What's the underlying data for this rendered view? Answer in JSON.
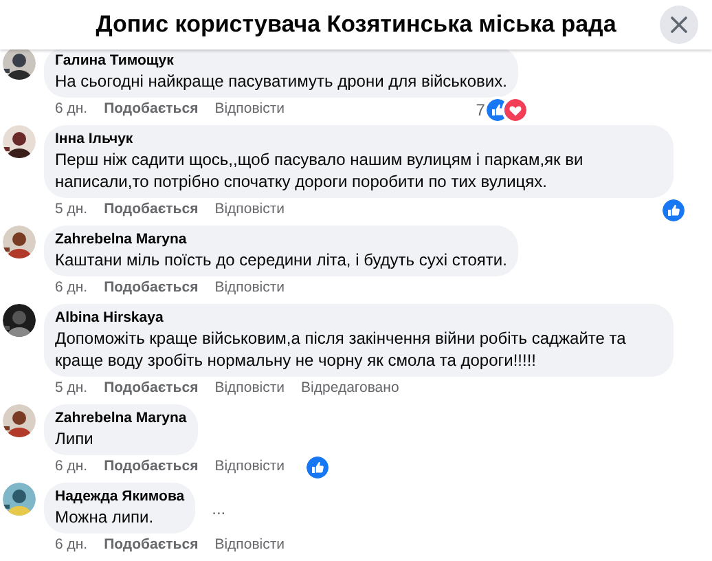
{
  "dialog": {
    "title": "Допис користувача Козятинська міська рада"
  },
  "comments": [
    {
      "author": "Галина Тимощук",
      "text": "На сьогодні найкраще пасуватимуть дрони для військових.",
      "time": "6 дн.",
      "like_label": "Подобається",
      "reply_label": "Відповісти",
      "reactions": {
        "count": "7",
        "icons": [
          {
            "kind": "like"
          },
          {
            "kind": "love"
          }
        ]
      }
    },
    {
      "author": "Інна Ільчук",
      "text": "Перш ніж садити щось,,щоб пасувало нашим вулицям і паркам,як ви написали,то потрібно спочатку дороги поробити по тих вулицях.",
      "time": "5 дн.",
      "like_label": "Подобається",
      "reply_label": "Відповісти",
      "reactions": {
        "icons": [
          {
            "kind": "like"
          }
        ]
      },
      "reactions_below": true
    },
    {
      "author": "Zahrebelna Maryna",
      "text": "Каштани міль поїсть до середини літа, і будуть сухі стояти.",
      "time": "6 дн.",
      "like_label": "Подобається",
      "reply_label": "Відповісти"
    },
    {
      "author": "Albina Hirskaya",
      "text": "Допоможіть краще військовим,а після закінчення війни робіть саджайте та краще воду зробіть нормальну не чорну як смола та дороги!!!!!",
      "time": "5 дн.",
      "like_label": "Подобається",
      "reply_label": "Відповісти",
      "edited_label": "Відредаговано"
    },
    {
      "author": "Zahrebelna Maryna",
      "text": "Липи",
      "time": "6 дн.",
      "like_label": "Подобається",
      "reply_label": "Відповісти",
      "reactions": {
        "icons": [
          {
            "kind": "like"
          }
        ]
      }
    },
    {
      "author": "Надежда Якимова",
      "text": "Можна липи.",
      "time": "6 дн.",
      "like_label": "Подобається",
      "reply_label": "Відповісти",
      "more": "..."
    }
  ]
}
